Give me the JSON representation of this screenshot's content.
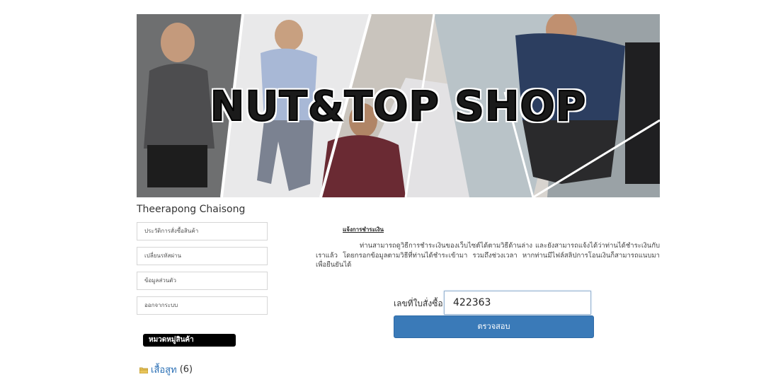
{
  "banner": {
    "title": "NUT&TOP SHOP"
  },
  "user": {
    "name": "Theerapong Chaisong"
  },
  "sidebar": {
    "menu": [
      {
        "label": "ประวัติการสั่งซื้อสินค้า"
      },
      {
        "label": "เปลี่ยนรหัสผ่าน"
      },
      {
        "label": "ข้อมูลส่วนตัว"
      },
      {
        "label": "ออกจากระบบ"
      }
    ],
    "category_header": "หมวดหมู่สินค้า",
    "categories": [
      {
        "label": "เสื้อสูท",
        "count": "(6)"
      }
    ]
  },
  "payment": {
    "title": "แจ้งการชำระเงิน",
    "description": "ท่านสามารถดูวิธีการชำระเงินของเว็บไซต์ได้ตามวิธีด้านล่าง และยังสามารถแจ้งได้ว่าท่านได้ชำระเงินกับเราแล้ว โดยกรอกข้อมูลตามวิธีที่ท่านได้ชำระเข้ามา รวมถึงช่วงเวลา หากท่านมีไฟล์สลิปการโอนเงินก็สามารถแนบมาเพื่อยืนยันได้",
    "order_label": "เลขที่ใบสั่งซื้อ",
    "order_value": "422363",
    "check_button": "ตรวจสอบ"
  },
  "colors": {
    "button": "#3a7ab8",
    "link": "#2a6fb5",
    "category_header_bg": "#000000"
  }
}
